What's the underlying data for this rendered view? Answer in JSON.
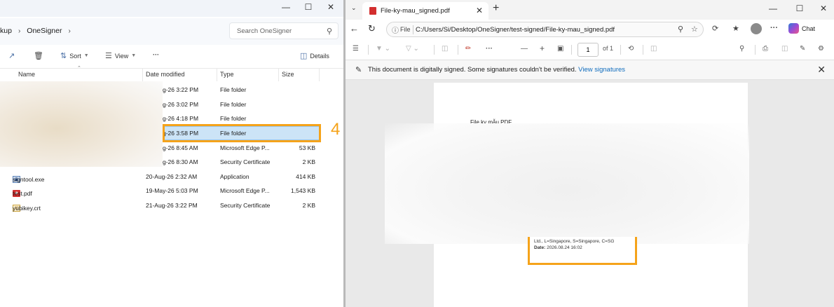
{
  "explorer": {
    "breadcrumb": [
      "kup",
      "OneSigner"
    ],
    "search_placeholder": "Search OneSigner",
    "toolbar": {
      "sort": "Sort",
      "view": "View",
      "more": "···",
      "details": "Details"
    },
    "columns": {
      "name": "Name",
      "date": "Date modified",
      "type": "Type",
      "size": "Size"
    },
    "rows": [
      {
        "name": "",
        "date": "g-26 3:22 PM",
        "type": "File folder",
        "size": ""
      },
      {
        "name": "",
        "date": "g-26 3:02 PM",
        "type": "File folder",
        "size": ""
      },
      {
        "name": "",
        "date": "g-26 4:18 PM",
        "type": "File folder",
        "size": ""
      },
      {
        "name": "",
        "date": "g-26 3:58 PM",
        "type": "File folder",
        "size": ""
      },
      {
        "name": "",
        "date": "g-26 8:45 AM",
        "type": "Microsoft Edge P...",
        "size": "53 KB"
      },
      {
        "name": "",
        "date": "g-26 8:30 AM",
        "type": "Security Certificate",
        "size": "2 KB"
      },
      {
        "name": "signtool.exe",
        "date": "20-Aug-26 2:32 AM",
        "type": "Application",
        "size": "414 KB"
      },
      {
        "name": "test.pdf",
        "date": "19-May-26 5:03 PM",
        "type": "Microsoft Edge P...",
        "size": "1,543 KB"
      },
      {
        "name": "yubikey.crt",
        "date": "21-Aug-26 3:22 PM",
        "type": "Security Certificate",
        "size": "2 KB"
      }
    ],
    "selected_row": 3,
    "step_number": "4"
  },
  "edge": {
    "tab_title": "File-ky-mau_signed.pdf",
    "url_label": "File",
    "url": "C:/Users/Si/Desktop/OneSigner/test-signed/File-ky-mau_signed.pdf",
    "chat_label": "Chat",
    "page_number": "1",
    "page_total": "of 1",
    "sig_message": "This document is digitally signed. Some signatures couldn't be verified.",
    "sig_link": "View signatures",
    "pdf_title": "File ky mẫu PDF",
    "signature_lines": [
      "Ltd., L=Singapore, S=Singapore, C=SG"
    ],
    "signature_date_label": "Date:",
    "signature_date": "2026.08.24 16:02"
  },
  "colors": {
    "accent": "#f5a31a",
    "selection": "#cce4f7",
    "link": "#0f6cbd"
  }
}
